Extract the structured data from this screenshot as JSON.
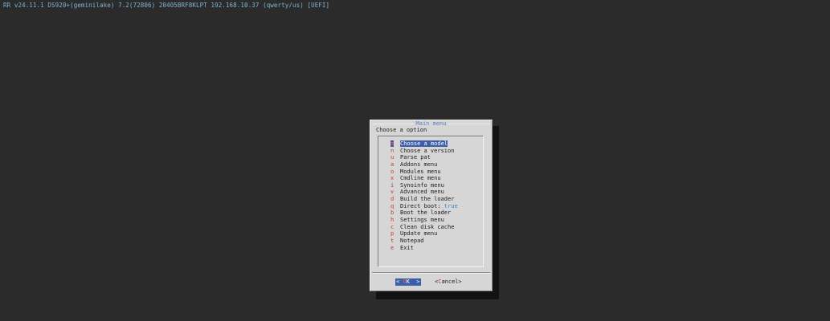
{
  "status_bar": "RR v24.11.1 DS920+(geminilake) 7.2(72806) 20405BRF8KLPT 192.168.10.37 (qwerty/us) [UEFI]",
  "dialog": {
    "title": "Main menu",
    "prompt": "Choose a option",
    "selected_index": 0,
    "items": [
      {
        "key": "m",
        "label": "Choose a model"
      },
      {
        "key": "n",
        "label": "Choose a version"
      },
      {
        "key": "u",
        "label": "Parse pat"
      },
      {
        "key": "a",
        "label": "Addons menu"
      },
      {
        "key": "o",
        "label": "Modules menu"
      },
      {
        "key": "x",
        "label": "Cmdline menu"
      },
      {
        "key": "i",
        "label": "Synoinfo menu"
      },
      {
        "key": "v",
        "label": "Advanced menu"
      },
      {
        "key": "d",
        "label": "Build the loader"
      },
      {
        "key": "q",
        "label": "Direct boot:",
        "value": "true"
      },
      {
        "key": "b",
        "label": "Boot the loader"
      },
      {
        "key": "h",
        "label": "Settings menu"
      },
      {
        "key": "c",
        "label": "Clean disk cache"
      },
      {
        "key": "p",
        "label": "Update menu"
      },
      {
        "key": "t",
        "label": "Notepad"
      },
      {
        "key": "e",
        "label": "Exit"
      }
    ],
    "buttons": {
      "ok": {
        "open": "< ",
        "hot": "O",
        "rest": "K  >"
      },
      "cancel": {
        "open": "<",
        "hot": "C",
        "rest": "ancel>"
      }
    }
  },
  "colors": {
    "background": "#2b2b2b",
    "dialog": "#d6d6d6",
    "highlight": "#3c5ea8",
    "hotkey": "#c23a3a",
    "value": "#3a86c9",
    "status_text": "#7fb3d5"
  }
}
